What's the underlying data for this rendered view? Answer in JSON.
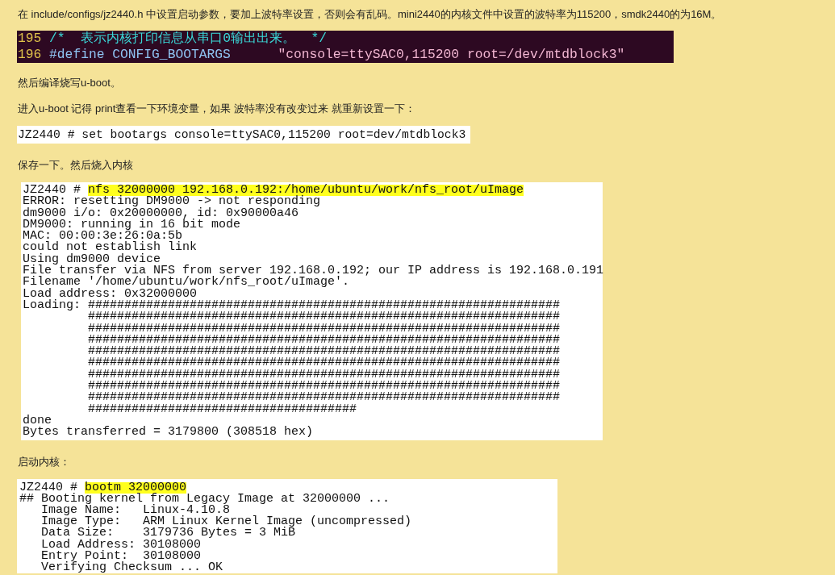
{
  "blocks": [
    {
      "kind": "text",
      "text": "在 include/configs/jz2440.h 中设置启动参数，要加上波特率设置，否则会有乱码。mini2440的内核文件中设置的波特率为115200，smdk2440的为16M。"
    },
    {
      "kind": "code",
      "lines": [
        {
          "number": "195",
          "segments": [
            {
              "kind": "comment",
              "text": "/*  表示内核打印信息从串口0输出出来。  */"
            }
          ]
        },
        {
          "number": "196",
          "segments": [
            {
              "kind": "directive",
              "text": "#define CONFIG_BOOTARGS"
            },
            {
              "kind": "string",
              "text": "\"console=ttySAC0,115200 root=/dev/mtdblock3\""
            }
          ]
        }
      ]
    },
    {
      "kind": "text",
      "text": "然后编译烧写u-boot。"
    },
    {
      "kind": "text",
      "text": "进入u-boot 记得 print查看一下环境变量，如果 波特率没有改变过来 就重新设置一下："
    },
    {
      "kind": "terminal",
      "lines": [
        {
          "kind": "command",
          "prompt": "JZ2440 #",
          "command": "set bootargs console=ttySAC0,115200 root=dev/mtdblock3",
          "highlighted": false
        }
      ]
    },
    {
      "kind": "text",
      "text": "保存一下。然后烧入内核"
    },
    {
      "kind": "terminal",
      "lines": [
        {
          "kind": "command",
          "prompt": "JZ2440 #",
          "command": "nfs 32000000 192.168.0.192:/home/ubuntu/work/nfs_root/uImage",
          "highlighted": true
        },
        {
          "kind": "output",
          "text": "ERROR: resetting DM9000 -> not responding"
        },
        {
          "kind": "output",
          "text": "dm9000 i/o: 0x20000000, id: 0x90000a46"
        },
        {
          "kind": "output",
          "text": "DM9000: running in 16 bit mode"
        },
        {
          "kind": "output",
          "text": "MAC: 00:00:3e:26:0a:5b"
        },
        {
          "kind": "output",
          "text": "could not establish link"
        },
        {
          "kind": "output",
          "text": "Using dm9000 device"
        },
        {
          "kind": "output",
          "text": "File transfer via NFS from server 192.168.0.192; our IP address is 192.168.0.191"
        },
        {
          "kind": "output",
          "text": "Filename '/home/ubuntu/work/nfs_root/uImage'."
        },
        {
          "kind": "output",
          "text": "Load address: 0x32000000"
        },
        {
          "kind": "output",
          "text": "Loading: #################################################################"
        },
        {
          "kind": "output",
          "text": "         #################################################################"
        },
        {
          "kind": "output",
          "text": "         #################################################################"
        },
        {
          "kind": "output",
          "text": "         #################################################################"
        },
        {
          "kind": "output",
          "text": "         #################################################################"
        },
        {
          "kind": "output",
          "text": "         #################################################################"
        },
        {
          "kind": "output",
          "text": "         #################################################################"
        },
        {
          "kind": "output",
          "text": "         #################################################################"
        },
        {
          "kind": "output",
          "text": "         #################################################################"
        },
        {
          "kind": "output",
          "text": "         #####################################"
        },
        {
          "kind": "output",
          "text": "done"
        },
        {
          "kind": "output",
          "text": "Bytes transferred = 3179800 (308518 hex)"
        }
      ]
    },
    {
      "kind": "text",
      "text": "启动内核："
    },
    {
      "kind": "terminal",
      "lines": [
        {
          "kind": "command",
          "prompt": "JZ2440 #",
          "command": "bootm 32000000",
          "highlighted": true
        },
        {
          "kind": "output",
          "text": "## Booting kernel from Legacy Image at 32000000 ..."
        },
        {
          "kind": "output",
          "text": "   Image Name:   Linux-4.10.8"
        },
        {
          "kind": "output",
          "text": "   Image Type:   ARM Linux Kernel Image (uncompressed)"
        },
        {
          "kind": "output",
          "text": "   Data Size:    3179736 Bytes = 3 MiB"
        },
        {
          "kind": "output",
          "text": "   Load Address: 30108000"
        },
        {
          "kind": "output",
          "text": "   Entry Point:  30108000"
        },
        {
          "kind": "output",
          "text": "   Verifying Checksum ... OK"
        }
      ]
    }
  ]
}
